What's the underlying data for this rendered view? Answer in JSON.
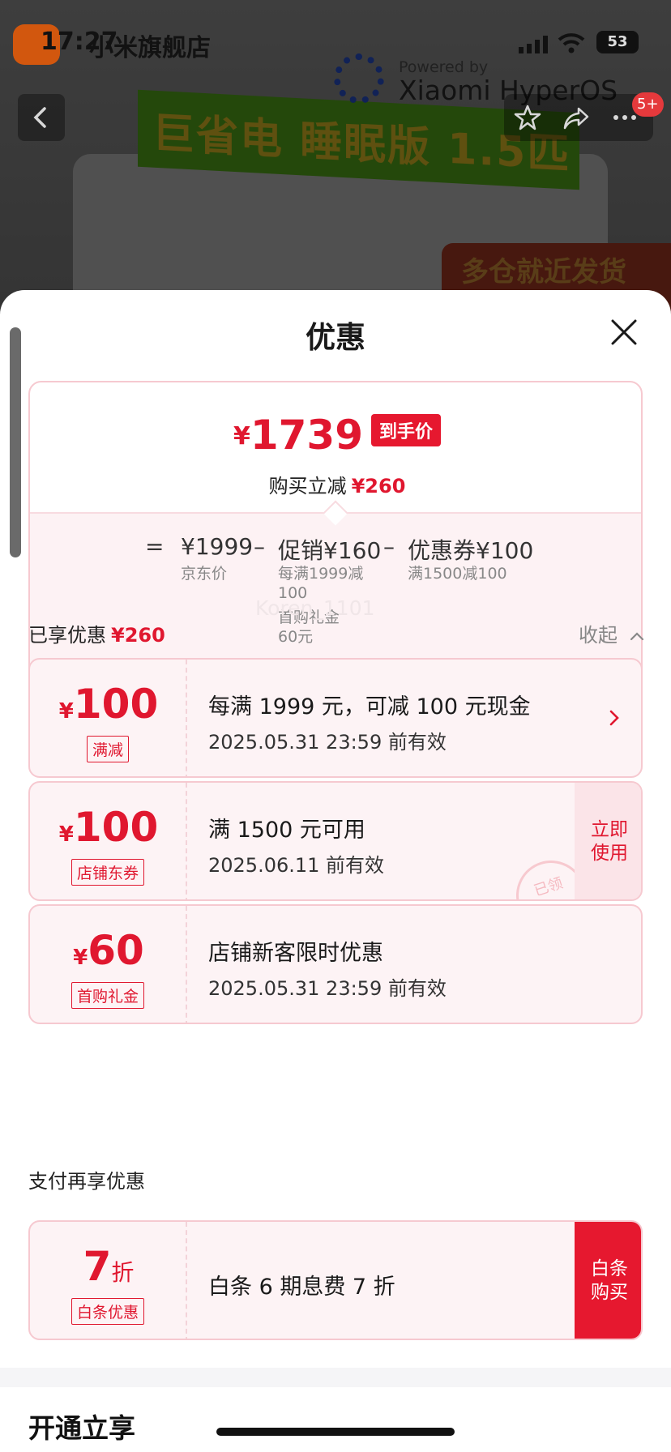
{
  "status_bar": {
    "time": "17:27",
    "store_name": "小米旗舰店",
    "battery": "53"
  },
  "product_bg": {
    "banner_text": "巨省电 睡眠版 1.5匹",
    "promo_tag": "多仓就近发货",
    "powered_by": "Powered by",
    "os_name": "Xiaomi HyperOS",
    "cart_badge": "5+"
  },
  "sheet": {
    "title": "优惠",
    "summary": {
      "currency": "¥",
      "final_price": "1739",
      "final_tag": "到手价",
      "reduce_label": "购买立减",
      "reduce_value": "¥260",
      "formula": {
        "eq": "=",
        "minus": "–",
        "base_value": "¥1999",
        "base_label": "京东价",
        "promo_value": "促销¥160",
        "promo_note_1": "每满1999减100",
        "promo_note_2": "首购礼金60元",
        "coupon_value": "优惠券¥100",
        "coupon_note": "满1500减100"
      }
    },
    "watermark": "Koren_1101",
    "enjoyed": {
      "label": "已享优惠",
      "value": "¥260",
      "collapse": "收起"
    },
    "coupons": [
      {
        "currency": "¥",
        "amount": "100",
        "tag": "满减",
        "title": "每满 1999 元，可减 100 元现金",
        "validity": "2025.05.31 23:59 前有效"
      },
      {
        "currency": "¥",
        "amount": "100",
        "tag": "店铺东券",
        "title": "满 1500 元可用",
        "validity": "2025.06.11 前有效",
        "action": "立即使用",
        "stamp": "已领"
      },
      {
        "currency": "¥",
        "amount": "60",
        "tag": "首购礼金",
        "title": "店铺新客限时优惠",
        "validity": "2025.05.31 23:59 前有效"
      }
    ],
    "pay": {
      "section_title": "支付再享优惠",
      "amount": "7",
      "unit": "折",
      "tag": "白条优惠",
      "title": "白条 6 期息费 7 折",
      "action": "白条购买"
    },
    "open_title": "开通立享"
  },
  "colors": {
    "accent_red": "#e0172f",
    "card_border": "#f6c9d0",
    "card_bg": "#fdf3f5"
  }
}
